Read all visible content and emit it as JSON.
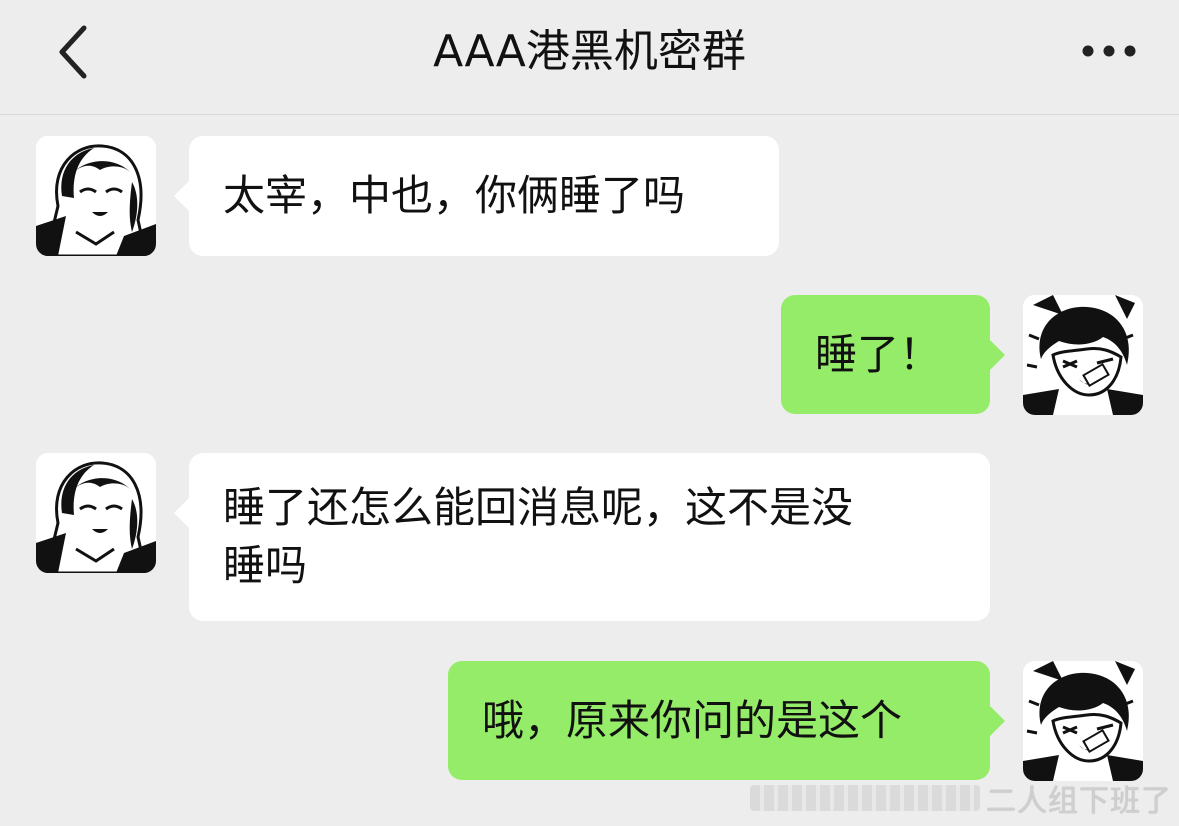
{
  "header": {
    "title": "AAA港黑机密群",
    "back_icon": "chevron-left-icon",
    "more_icon": "more-dots-icon"
  },
  "colors": {
    "background": "#ededed",
    "incoming_bubble": "#ffffff",
    "outgoing_bubble": "#95ec69",
    "text": "#111111"
  },
  "messages": [
    {
      "side": "left",
      "sender_avatar": "avatar-manga-long-hair",
      "text": "太宰，中也，你俩睡了吗"
    },
    {
      "side": "right",
      "sender_avatar": "avatar-manga-dark-hair-bandage",
      "text": "睡了！"
    },
    {
      "side": "left",
      "sender_avatar": "avatar-manga-long-hair",
      "text_line1": "睡了还怎么能回消息呢，这不是没",
      "text_line2": "睡吗"
    },
    {
      "side": "right",
      "sender_avatar": "avatar-manga-dark-hair-bandage",
      "text": "哦，原来你问的是这个"
    }
  ],
  "watermark": {
    "text": "二人组下班了"
  }
}
